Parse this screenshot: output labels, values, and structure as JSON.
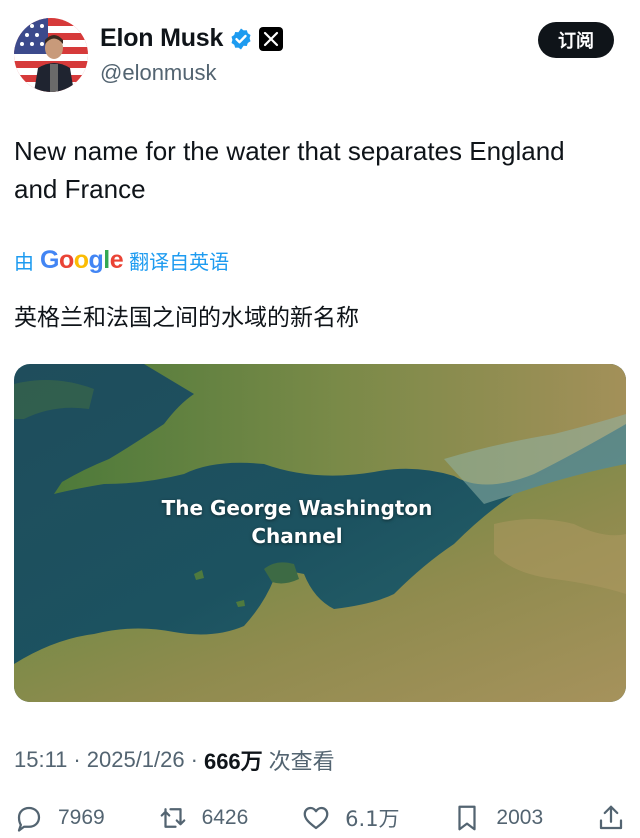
{
  "author": {
    "name": "Elon Musk",
    "handle": "@elonmusk"
  },
  "subscribe_label": "订阅",
  "tweet_text": "New name for the water that separates England and France",
  "translation": {
    "prefix": "由",
    "provider": "Google",
    "suffix": "翻译自英语",
    "text": "英格兰和法国之间的水域的新名称"
  },
  "image": {
    "caption_line1": "The George Washington",
    "caption_line2": "Channel"
  },
  "meta": {
    "time": "15:11",
    "date": "2025/1/26",
    "separator": "·",
    "views": "666万",
    "views_label": "次查看"
  },
  "actions": {
    "replies": "7969",
    "retweets": "6426",
    "likes": "6.1万",
    "bookmarks": "2003"
  },
  "colors": {
    "accent": "#1d9bf0",
    "text": "#0f1419",
    "muted": "#536471"
  }
}
